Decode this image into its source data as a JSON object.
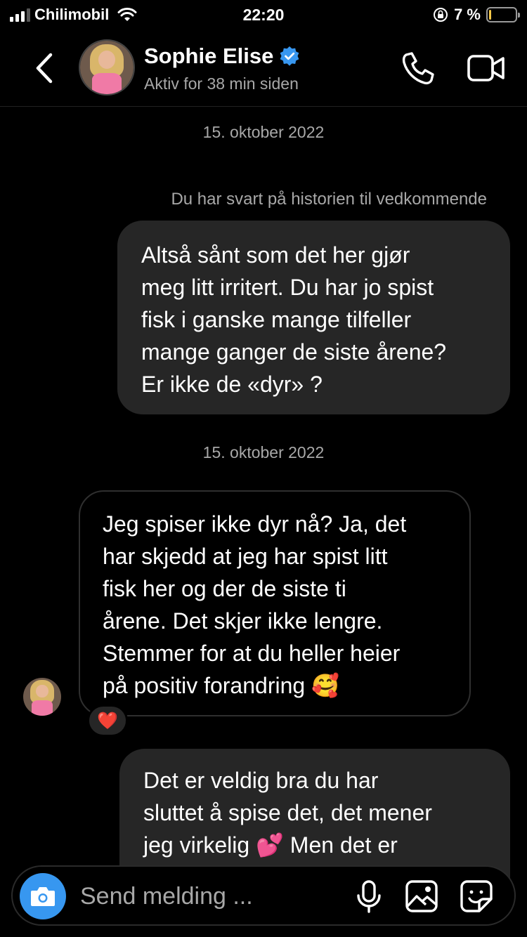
{
  "status_bar": {
    "carrier": "Chilimobil",
    "time": "22:20",
    "battery_percent_label": "7 %",
    "battery_level": 0.07,
    "signal_bars_active": 3,
    "signal_bars_total": 4,
    "battery_color": "#f7c948"
  },
  "header": {
    "name": "Sophie Elise",
    "status": "Aktiv for 38 min siden",
    "verified_color": "#3897f0",
    "icons": [
      "back-chevron-icon",
      "verified-badge-icon",
      "phone-icon",
      "video-camera-icon"
    ]
  },
  "chat": {
    "date_1": "15. oktober 2022",
    "story_reply_note": "Du har svart på historien til vedkommende",
    "message_1": "Altså sånt som det her gjør\nmeg litt irritert. Du har jo spist\nfisk i ganske mange tilfeller\nmange ganger de siste årene?\nEr ikke de «dyr» ?",
    "date_2": "15. oktober 2022",
    "message_2": "Jeg spiser ikke dyr nå? Ja, det\nhar skjedd at jeg har spist litt\nfisk her og der de siste ti\nårene. Det skjer ikke lengre.\nStemmer for at du heller heier\npå positiv forandring 🥰",
    "reaction": "❤️",
    "message_3": "Det er veldig bra du har\nsluttet å spise det, det mener\njeg virkelig 💕 Men det er"
  },
  "composer": {
    "placeholder": "Send melding ...",
    "accent_color": "#3797f0",
    "icons": [
      "camera-icon",
      "microphone-icon",
      "gallery-icon",
      "sticker-icon"
    ]
  }
}
